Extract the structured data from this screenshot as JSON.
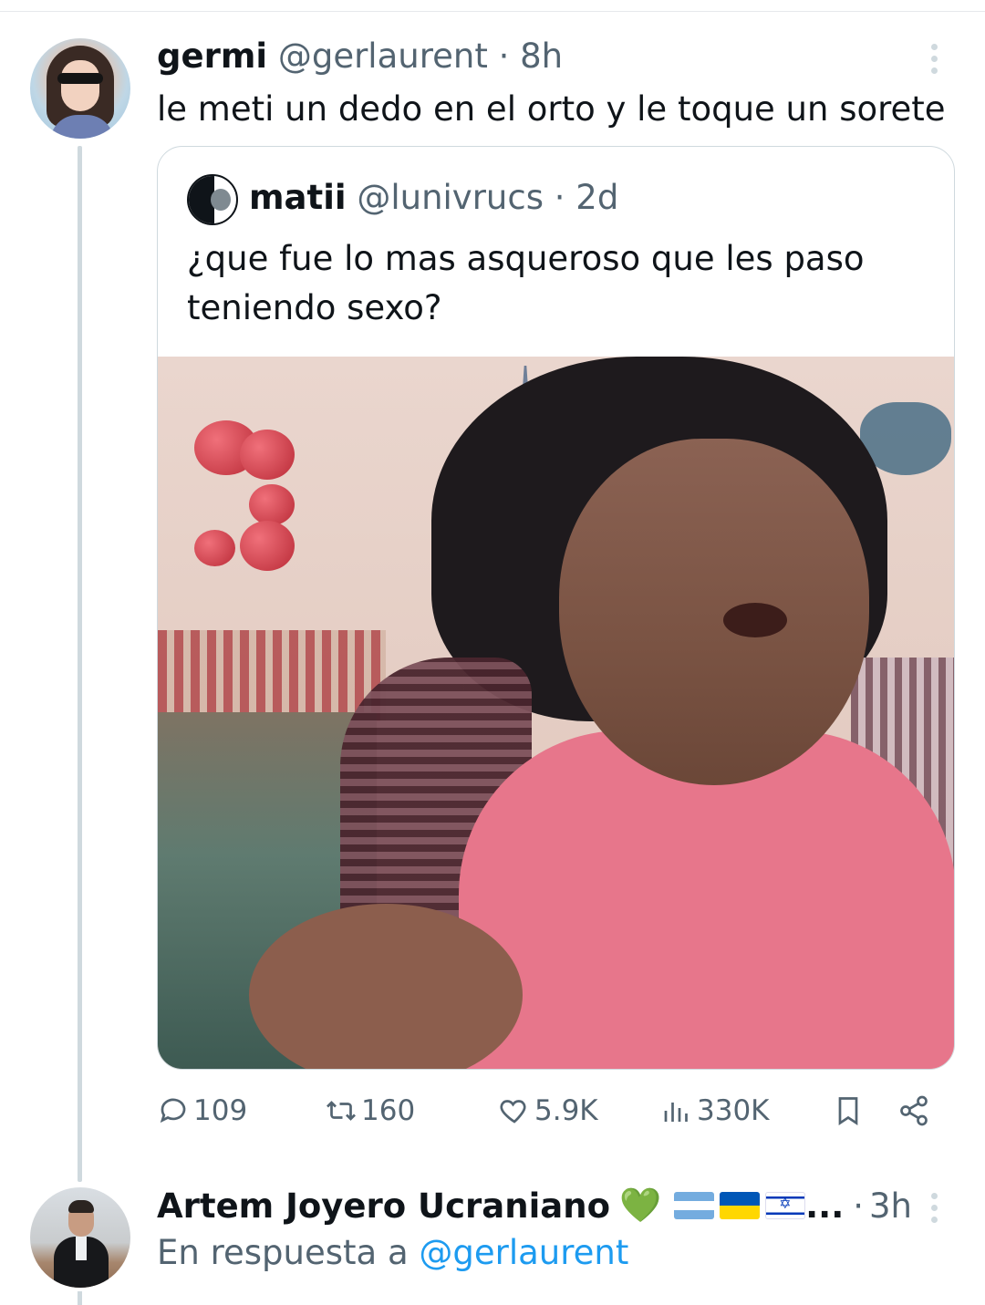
{
  "tweet": {
    "display_name": "germi",
    "handle": "@gerlaurent",
    "separator": "·",
    "time": "8h",
    "text": "le meti un dedo en el orto y le toque un sorete"
  },
  "quote": {
    "display_name": "matii",
    "handle": "@lunivrucs",
    "separator": "·",
    "time": "2d",
    "text": "¿que fue lo mas asqueroso que les paso teniendo sexo?"
  },
  "actions": {
    "replies": "109",
    "reposts": "160",
    "likes": "5.9K",
    "views": "330K"
  },
  "reply": {
    "display_name": "Artem Joyero Ucraniano",
    "emoji": "💚",
    "ellipsis": "...",
    "separator": "·",
    "time": "3h",
    "reply_prefix": "En respuesta a",
    "reply_handle": "@gerlaurent"
  },
  "icons": {
    "reply": "reply-icon",
    "repost": "repost-icon",
    "like": "heart-icon",
    "views": "views-icon",
    "bookmark": "bookmark-icon",
    "share": "share-icon",
    "more": "more-icon"
  },
  "colors": {
    "text": "#0f1419",
    "muted": "#536471",
    "link": "#1d9bf0",
    "border": "#cfd9de"
  }
}
